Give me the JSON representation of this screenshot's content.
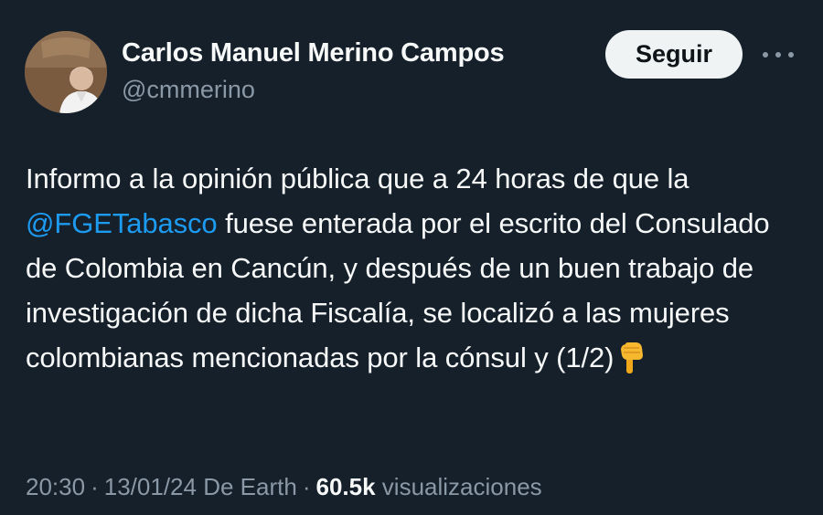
{
  "author": {
    "name": "Carlos Manuel Merino Campos",
    "handle": "@cmmerino"
  },
  "follow_button": {
    "label": "Seguir"
  },
  "more_icon": "more-horizontal-icon",
  "tweet": {
    "text_before": "Informo a la opinión pública que a 24 horas de que la ",
    "mention": "@FGETabasco",
    "text_after": " fuese enterada por el escrito del Consulado de Colombia en Cancún, y después de un buen trabajo de investigación de dicha Fiscalía, se localizó a las mujeres colombianas mencionadas por la cónsul y (1/2)",
    "emoji": "pointing-down-hand-emoji"
  },
  "meta": {
    "time": "20:30",
    "date": "13/01/24",
    "source": "De Earth",
    "views_count": "60.5k",
    "views_label": "visualizaciones",
    "separator": "·"
  },
  "colors": {
    "background": "#15202b",
    "text": "#f7f9f9",
    "secondary_text": "#8b98a5",
    "link": "#1d9bf0",
    "button_bg": "#eff3f4"
  }
}
